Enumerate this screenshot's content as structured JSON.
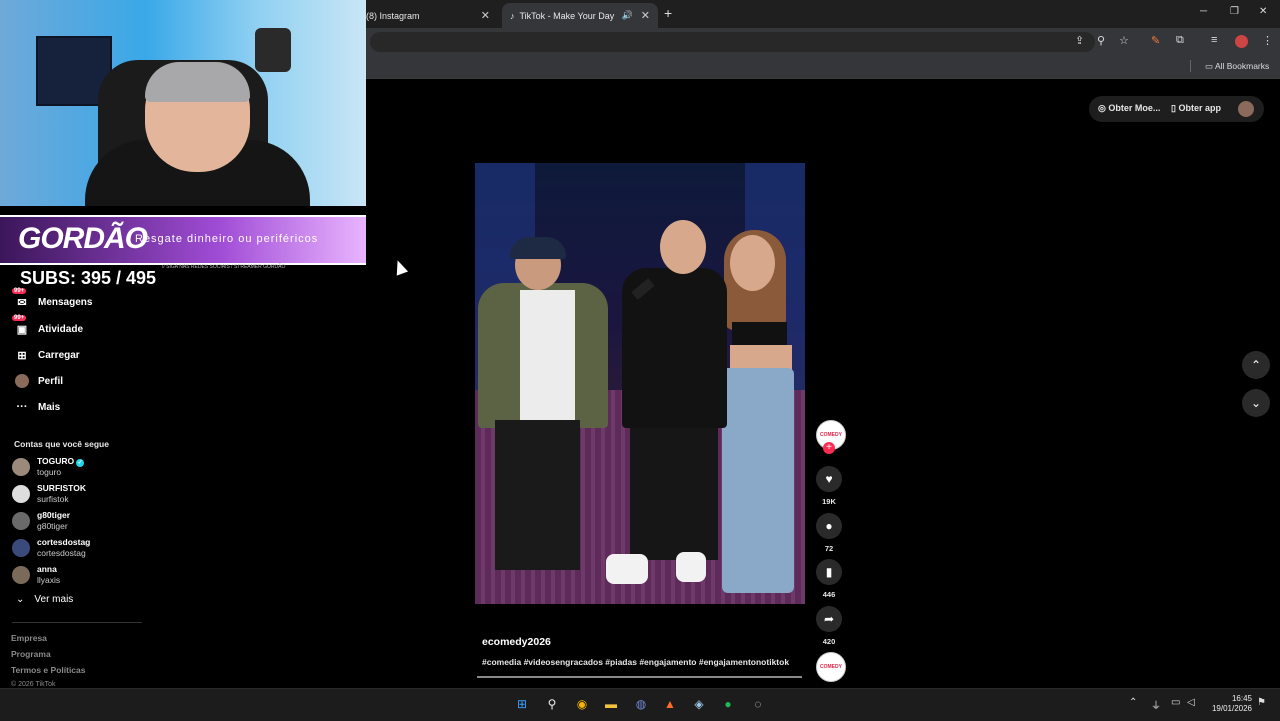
{
  "browser": {
    "tabs": [
      {
        "title": "(8) Instagram",
        "active": false
      },
      {
        "title": "TikTok - Make Your Day",
        "active": true
      }
    ],
    "new_tab_symbol": "+",
    "bookmarks_label": "All Bookmarks",
    "window_controls": [
      "─",
      "❐",
      "✕"
    ]
  },
  "overlay": {
    "logo_text": "GORDÃO",
    "banner_text": "Resgate dinheiro ou periféricos",
    "banner_subtext": "// SIGA NAS REDES SOCIAIS / STREAMER GORDÃO",
    "subs_text": "SUBS: 395 / 495"
  },
  "sidebar": {
    "nav": [
      {
        "label": "Mensagens",
        "icon": "messages-icon",
        "badge": "99+"
      },
      {
        "label": "Atividade",
        "icon": "activity-icon",
        "badge": "99+"
      },
      {
        "label": "Carregar",
        "icon": "upload-icon"
      },
      {
        "label": "Perfil",
        "icon": "profile-icon"
      },
      {
        "label": "Mais",
        "icon": "more-icon"
      }
    ],
    "following_title": "Contas que você segue",
    "accounts": [
      {
        "name": "TOGURO",
        "handle": "toguro",
        "verified": true
      },
      {
        "name": "SURFISTOK",
        "handle": "surfistok"
      },
      {
        "name": "g80tiger",
        "handle": "g80tiger"
      },
      {
        "name": "cortesdostag",
        "handle": "cortesdostag"
      },
      {
        "name": "anna",
        "handle": "llyaxis"
      }
    ],
    "see_more": "Ver mais",
    "footer": [
      "Empresa",
      "Programa",
      "Termos e Políticas"
    ],
    "copyright": "© 2026 TikTok"
  },
  "topbar": {
    "coins_label": "Obter Moe...",
    "app_label": "Obter app"
  },
  "video": {
    "author": "ecomedy2026",
    "description": "#comedia #videosengracados #piadas #engajamento #engajamentonotiktok",
    "creator_badge": "COMEDY",
    "likes": "19K",
    "comments": "72",
    "saves": "446",
    "shares": "420"
  },
  "taskbar": {
    "time": "16:45",
    "date": "19/01/2026"
  },
  "colors": {
    "accent": "#fe2c55",
    "verified": "#20d5ec",
    "banner": "#a04cd6"
  }
}
